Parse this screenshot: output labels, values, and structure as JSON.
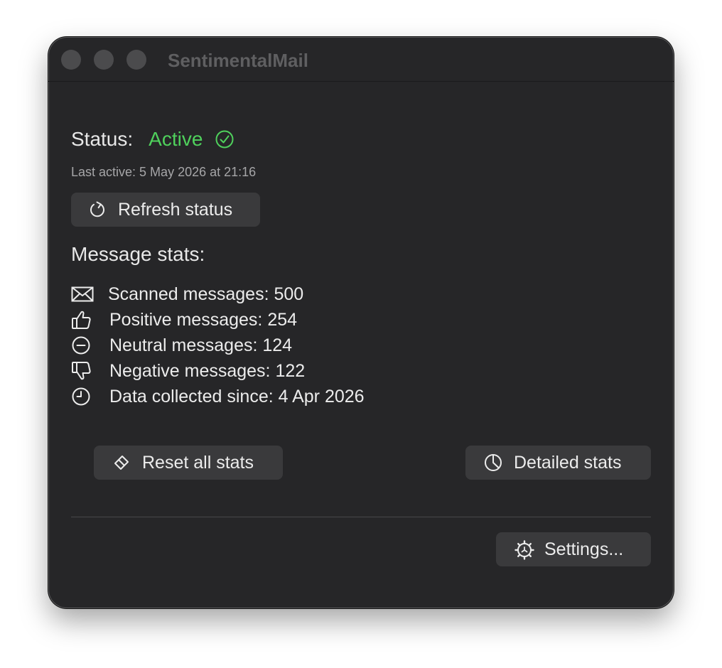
{
  "window": {
    "title": "SentimentalMail"
  },
  "status": {
    "label": "Status:",
    "value": "Active",
    "value_color": "#4fd05c",
    "icon": "checkmark-circle-icon",
    "last_active": "Last active: 5 May 2026 at 21:16"
  },
  "buttons": {
    "refresh": {
      "label": "Refresh status",
      "icon": "refresh-icon"
    },
    "reset": {
      "label": "Reset all stats",
      "icon": "eraser-icon"
    },
    "detailed": {
      "label": "Detailed stats",
      "icon": "pie-chart-icon"
    },
    "settings": {
      "label": "Settings...",
      "icon": "gear-icon"
    }
  },
  "stats": {
    "title": "Message stats:",
    "items": [
      {
        "label": "Scanned messages: 500",
        "icon": "envelope-icon"
      },
      {
        "label": "Positive messages: 254",
        "icon": "thumbs-up-icon"
      },
      {
        "label": "Neutral messages: 124",
        "icon": "minus-circle-icon"
      },
      {
        "label": "Negative messages: 122",
        "icon": "thumbs-down-icon"
      },
      {
        "label": "Data collected since: 4 Apr 2026",
        "icon": "clock-icon"
      }
    ]
  }
}
